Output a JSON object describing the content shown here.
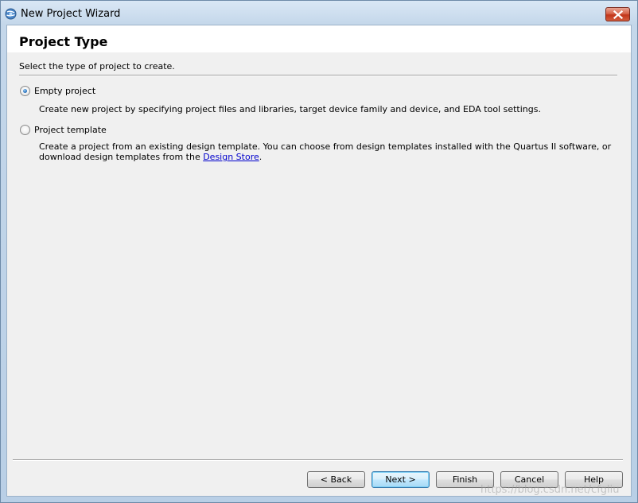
{
  "window": {
    "title": "New Project Wizard",
    "icon": "quartus-globe-icon",
    "close_icon": "close-icon"
  },
  "page": {
    "title": "Project Type",
    "instruction": "Select the type of project to create."
  },
  "options": [
    {
      "label": "Empty project",
      "checked": true,
      "description": "Create new project by specifying project files and libraries, target device family and device, and EDA tool settings."
    },
    {
      "label": "Project template",
      "checked": false,
      "description_pre": "Create a project from an existing design template. You can choose from design templates installed with the Quartus II software, or download design templates from the ",
      "link_text": "Design Store",
      "description_post": "."
    }
  ],
  "buttons": {
    "back": "< Back",
    "next": "Next >",
    "finish": "Finish",
    "cancel": "Cancel",
    "help": "Help"
  },
  "watermark": "https://blog.csdn.net/cfgliu",
  "colors": {
    "link": "#0000cc",
    "title_bar": "#c4d7ea",
    "close_button": "#c2361b"
  }
}
